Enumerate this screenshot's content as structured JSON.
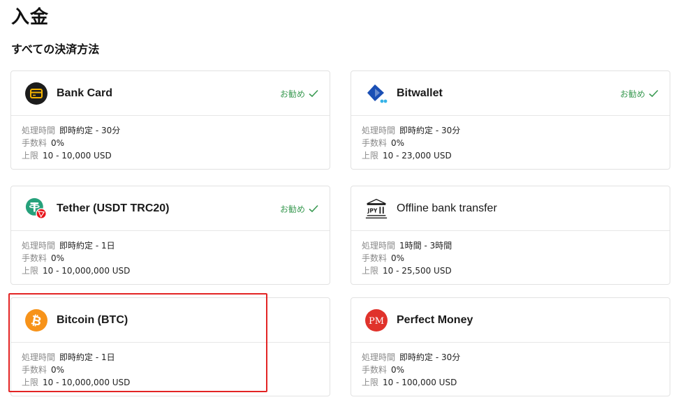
{
  "page": {
    "title": "入金",
    "section_title": "すべての決済方法"
  },
  "labels": {
    "processing_time": "処理時間",
    "fee": "手数料",
    "limit": "上限",
    "recommended": "お勧め"
  },
  "colors": {
    "recommended": "#3a9a52",
    "highlight_border": "#e32424"
  },
  "methods": [
    {
      "name": "Bank Card",
      "icon": "bank-card-icon",
      "recommended": true,
      "processing_time": "即時約定 - 30分",
      "fee": "0%",
      "limit": "10 - 10,000 USD"
    },
    {
      "name": "Bitwallet",
      "icon": "bitwallet-icon",
      "recommended": true,
      "processing_time": "即時約定 - 30分",
      "fee": "0%",
      "limit": "10 - 23,000 USD"
    },
    {
      "name": "Tether (USDT TRC20)",
      "icon": "tether-trc20-icon",
      "recommended": true,
      "processing_time": "即時約定 - 1日",
      "fee": "0%",
      "limit": "10 - 10,000,000 USD"
    },
    {
      "name": "Offline bank transfer",
      "icon": "jpy-bank-icon",
      "recommended": false,
      "processing_time": "1時間 - 3時間",
      "fee": "0%",
      "limit": "10 - 25,500 USD"
    },
    {
      "name": "Bitcoin (BTC)",
      "icon": "bitcoin-icon",
      "recommended": false,
      "processing_time": "即時約定 - 1日",
      "fee": "0%",
      "limit": "10 - 10,000,000 USD",
      "highlighted": true
    },
    {
      "name": "Perfect Money",
      "icon": "perfect-money-icon",
      "recommended": false,
      "processing_time": "即時約定 - 30分",
      "fee": "0%",
      "limit": "10 - 100,000 USD"
    }
  ]
}
